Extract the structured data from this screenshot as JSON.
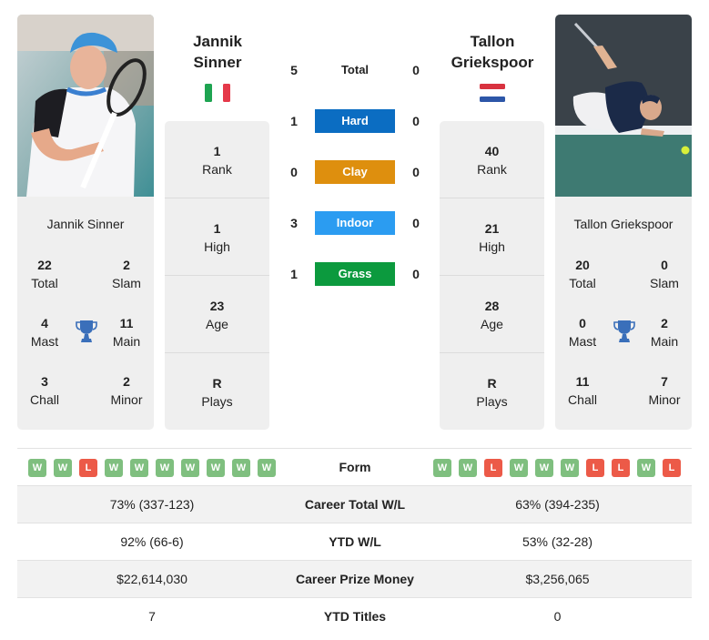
{
  "colors": {
    "hard": "#0b6dc2",
    "clay": "#de8f0e",
    "indoor": "#2b9cf1",
    "grass": "#0c9a3e",
    "win": "#7fbf7f",
    "loss": "#ec5a48",
    "trophy": "#3a6fba"
  },
  "player1": {
    "name_line1": "Jannik",
    "name_line2": "Sinner",
    "full_name": "Jannik Sinner",
    "flag": "italy-flag",
    "titles": {
      "total": {
        "value": "22",
        "label": "Total"
      },
      "slam": {
        "value": "2",
        "label": "Slam"
      },
      "mast": {
        "value": "4",
        "label": "Mast"
      },
      "main": {
        "value": "11",
        "label": "Main"
      },
      "chall": {
        "value": "3",
        "label": "Chall"
      },
      "minor": {
        "value": "2",
        "label": "Minor"
      }
    },
    "stats": [
      {
        "value": "1",
        "label": "Rank"
      },
      {
        "value": "1",
        "label": "High"
      },
      {
        "value": "23",
        "label": "Age"
      },
      {
        "value": "R",
        "label": "Plays"
      }
    ],
    "form": [
      "W",
      "W",
      "L",
      "W",
      "W",
      "W",
      "W",
      "W",
      "W",
      "W"
    ]
  },
  "player2": {
    "name_line1": "Tallon",
    "name_line2": "Griekspoor",
    "full_name": "Tallon Griekspoor",
    "flag": "netherlands-flag",
    "titles": {
      "total": {
        "value": "20",
        "label": "Total"
      },
      "slam": {
        "value": "0",
        "label": "Slam"
      },
      "mast": {
        "value": "0",
        "label": "Mast"
      },
      "main": {
        "value": "2",
        "label": "Main"
      },
      "chall": {
        "value": "11",
        "label": "Chall"
      },
      "minor": {
        "value": "7",
        "label": "Minor"
      }
    },
    "stats": [
      {
        "value": "40",
        "label": "Rank"
      },
      {
        "value": "21",
        "label": "High"
      },
      {
        "value": "28",
        "label": "Age"
      },
      {
        "value": "R",
        "label": "Plays"
      }
    ],
    "form": [
      "W",
      "W",
      "L",
      "W",
      "W",
      "W",
      "L",
      "L",
      "W",
      "L"
    ]
  },
  "h2h": [
    {
      "label": "Total",
      "p1": "5",
      "p2": "0",
      "surface": "total"
    },
    {
      "label": "Hard",
      "p1": "1",
      "p2": "0",
      "surface": "hard"
    },
    {
      "label": "Clay",
      "p1": "0",
      "p2": "0",
      "surface": "clay"
    },
    {
      "label": "Indoor",
      "p1": "3",
      "p2": "0",
      "surface": "indoor"
    },
    {
      "label": "Grass",
      "p1": "1",
      "p2": "0",
      "surface": "grass"
    }
  ],
  "table": {
    "form_label": "Form",
    "rows": [
      {
        "label": "Career Total W/L",
        "p1": "73% (337-123)",
        "p2": "63% (394-235)"
      },
      {
        "label": "YTD W/L",
        "p1": "92% (66-6)",
        "p2": "53% (32-28)"
      },
      {
        "label": "Career Prize Money",
        "p1": "$22,614,030",
        "p2": "$3,256,065"
      },
      {
        "label": "YTD Titles",
        "p1": "7",
        "p2": "0"
      }
    ]
  }
}
